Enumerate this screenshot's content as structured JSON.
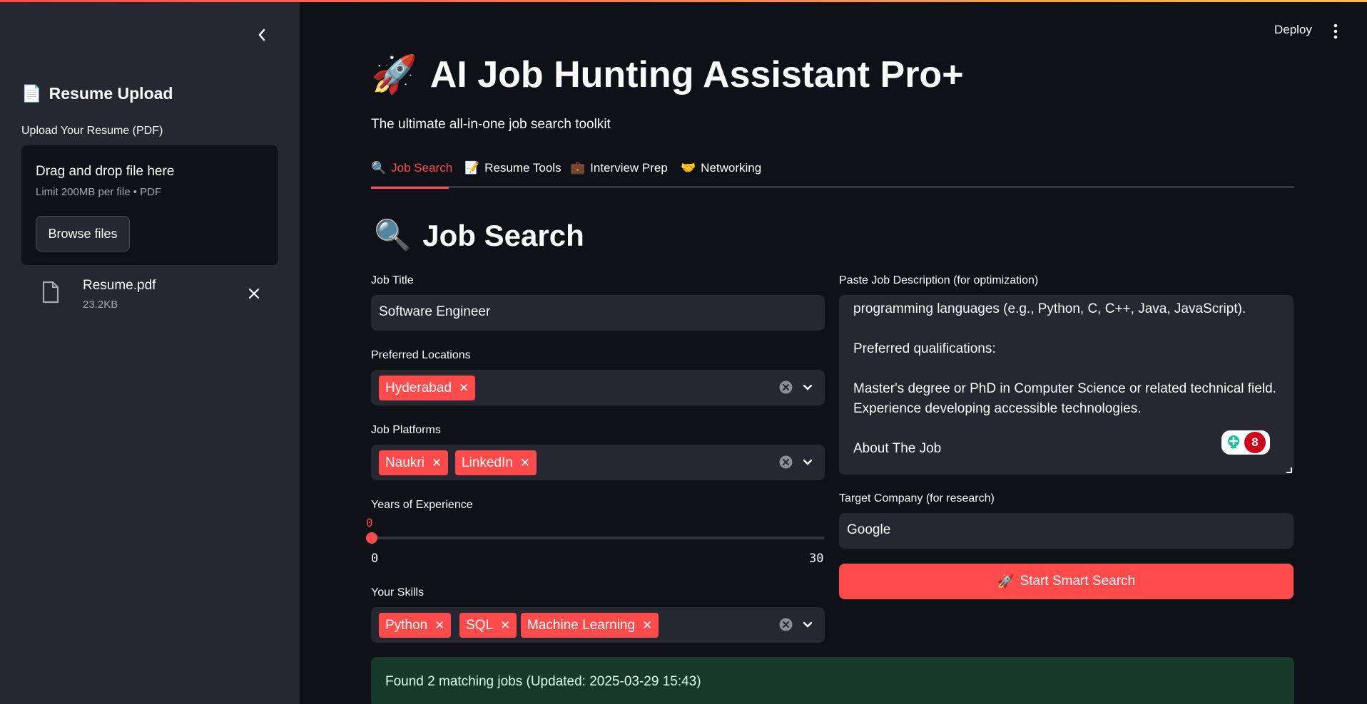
{
  "topbar": {
    "deploy_label": "Deploy"
  },
  "sidebar": {
    "header_icon": "📄",
    "header": "Resume Upload",
    "upload_label": "Upload Your Resume (PDF)",
    "dropzone": {
      "title": "Drag and drop file here",
      "subtitle": "Limit 200MB per file • PDF",
      "browse_label": "Browse files"
    },
    "uploaded_file": {
      "name": "Resume.pdf",
      "size": "23.2KB"
    }
  },
  "main": {
    "title_icon": "🚀",
    "title": "AI Job Hunting Assistant Pro+",
    "subtitle": "The ultimate all-in-one job search toolkit",
    "tabs": [
      {
        "icon": "🔍",
        "label": "Job Search",
        "active": true
      },
      {
        "icon": "📝",
        "label": "Resume Tools"
      },
      {
        "icon": "💼",
        "label": "Interview Prep"
      },
      {
        "icon": "🤝",
        "label": "Networking"
      }
    ],
    "section_icon": "🔍",
    "section_title": "Job Search"
  },
  "form": {
    "job_title": {
      "label": "Job Title",
      "value": "Software Engineer"
    },
    "locations": {
      "label": "Preferred Locations",
      "selected": [
        "Hyderabad"
      ]
    },
    "platforms": {
      "label": "Job Platforms",
      "selected": [
        "Naukri",
        "LinkedIn"
      ]
    },
    "experience": {
      "label": "Years of Experience",
      "value": "0",
      "min": "0",
      "max": "30"
    },
    "skills": {
      "label": "Your Skills",
      "selected": [
        "Python",
        "SQL",
        "Machine Learning"
      ]
    },
    "job_description": {
      "label": "Paste Job Description (for optimization)",
      "lines": [
        "programming languages (e.g., Python, C, C++, Java, JavaScript).",
        "",
        "Preferred qualifications:",
        "",
        "Master's degree or PhD in Computer Science or related technical field.",
        "Experience developing accessible technologies.",
        "",
        "About The Job"
      ],
      "grammar_count": "8"
    },
    "company": {
      "label": "Target Company (for research)",
      "value": "Google"
    },
    "search_button": {
      "icon": "🚀",
      "label": "Start Smart Search"
    }
  },
  "results": {
    "message": "Found 2 matching jobs (Updated: 2025-03-29 15:43)"
  },
  "colors": {
    "accent": "#ff4b4b",
    "sidebar_bg": "#262730",
    "app_bg": "#0e1117",
    "success_bg": "#173928"
  }
}
